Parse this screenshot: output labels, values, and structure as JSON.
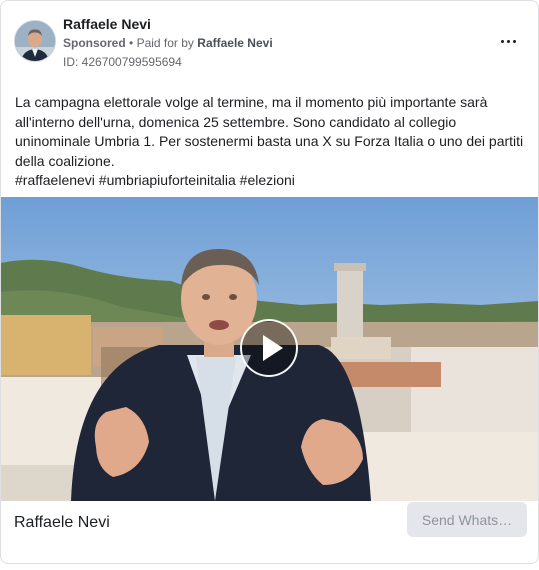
{
  "ad": {
    "advertiser_name": "Raffaele Nevi",
    "sponsored_label": "Sponsored",
    "paid_for_by_label": "Paid for by",
    "paid_for_by_name": "Raffaele Nevi",
    "id_text": "ID: 426700799595694"
  },
  "body": {
    "paragraph": "La campagna elettorale volge al termine, ma il momento più importante sarà all'interno dell'urna, domenica 25 settembre. Sono candidato al collegio uninominale Umbria 1. Per sostenermi basta una X su Forza Italia o uno dei partiti della coalizione.",
    "hashtags": "#raffaelenevi #umbriapiuforteinitalia #elezioni"
  },
  "footer": {
    "page_name": "Raffaele Nevi",
    "cta_label": "Send Whats…"
  },
  "icons": {
    "more": "more-options-icon",
    "play": "play-icon"
  },
  "colors": {
    "secondary_text": "#65676b",
    "cta_background": "#e4e6eb",
    "cta_text": "#8d949e"
  }
}
